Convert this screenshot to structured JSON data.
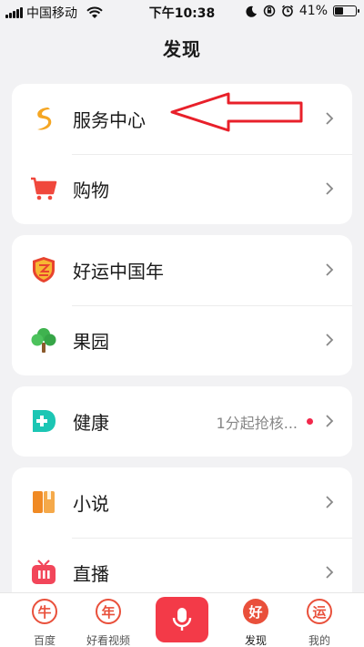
{
  "status_bar": {
    "carrier": "中国移动",
    "time": "下午10:38",
    "battery": "41%",
    "battery_level": 0.41
  },
  "header": {
    "title": "发现"
  },
  "groups": [
    {
      "items": [
        {
          "label": "服务中心",
          "icon": "service-center-icon"
        },
        {
          "label": "购物",
          "icon": "shopping-cart-icon"
        }
      ]
    },
    {
      "items": [
        {
          "label": "好运中国年",
          "icon": "lucky-badge-icon"
        },
        {
          "label": "果园",
          "icon": "tree-icon"
        }
      ]
    },
    {
      "items": [
        {
          "label": "健康",
          "icon": "health-icon",
          "note": "1分起抢核..."
        }
      ]
    },
    {
      "items": [
        {
          "label": "小说",
          "icon": "book-icon"
        },
        {
          "label": "直播",
          "icon": "live-tv-icon"
        }
      ]
    }
  ],
  "tab_bar": {
    "tabs": [
      {
        "label": "百度",
        "badge": "牛"
      },
      {
        "label": "好看视频",
        "badge": "年"
      },
      {
        "label": "",
        "icon": "microphone-icon"
      },
      {
        "label": "发现",
        "badge": "好"
      },
      {
        "label": "我的",
        "badge": "运"
      }
    ]
  },
  "colors": {
    "accent": "#f33a48",
    "service_icon": "#f5a623",
    "shopping_icon": "#f0473c",
    "health_icon": "#1cc6b4",
    "book_icon": "#f08a24",
    "annotation_arrow": "#e8202a"
  }
}
